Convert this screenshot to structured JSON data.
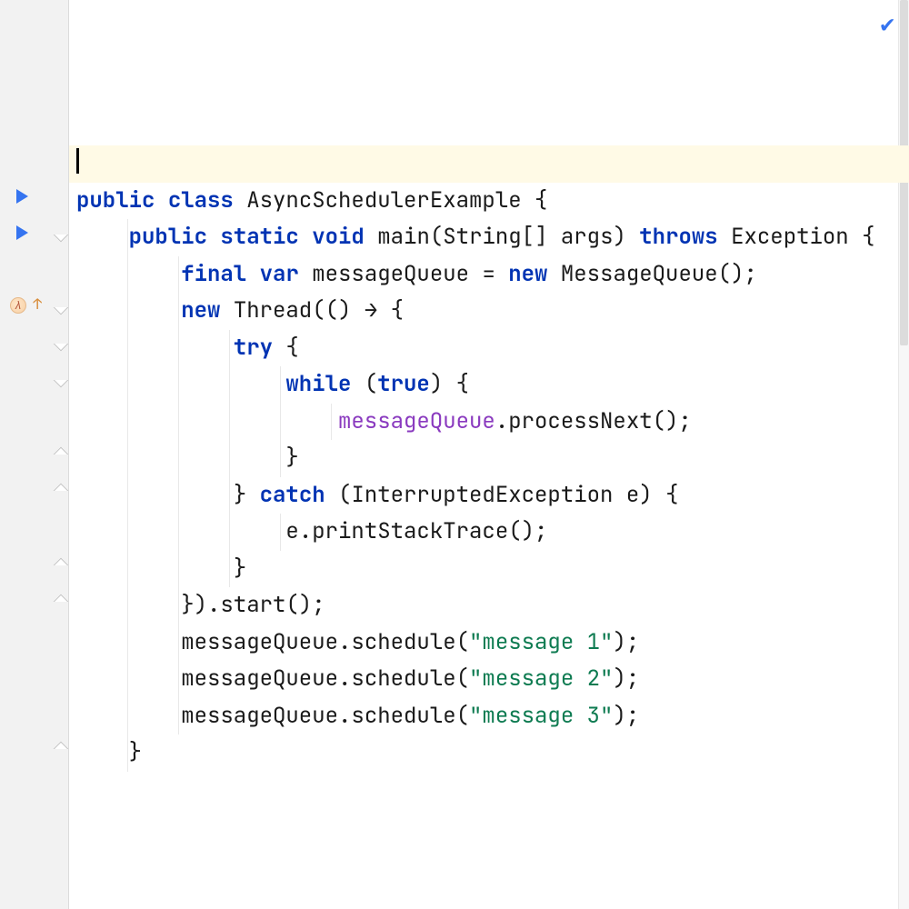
{
  "lines": [
    {
      "indent": 0,
      "type": "cursor"
    },
    {
      "indent": 0,
      "tokens": [
        {
          "t": "kw",
          "v": "public"
        },
        {
          "t": "sp",
          "v": " "
        },
        {
          "t": "kw",
          "v": "class"
        },
        {
          "t": "sp",
          "v": " "
        },
        {
          "t": "id",
          "v": "AsyncSchedulerExample"
        },
        {
          "t": "sp",
          "v": " "
        },
        {
          "t": "punc",
          "v": "{"
        }
      ]
    },
    {
      "indent": 1,
      "tokens": [
        {
          "t": "kw",
          "v": "public"
        },
        {
          "t": "sp",
          "v": " "
        },
        {
          "t": "kw",
          "v": "static"
        },
        {
          "t": "sp",
          "v": " "
        },
        {
          "t": "kw",
          "v": "void"
        },
        {
          "t": "sp",
          "v": " "
        },
        {
          "t": "fn",
          "v": "main"
        },
        {
          "t": "punc",
          "v": "("
        },
        {
          "t": "id",
          "v": "String[] args"
        },
        {
          "t": "punc",
          "v": ")"
        },
        {
          "t": "sp",
          "v": " "
        },
        {
          "t": "kw",
          "v": "throws"
        },
        {
          "t": "sp",
          "v": " "
        },
        {
          "t": "id",
          "v": "Exception"
        },
        {
          "t": "sp",
          "v": " "
        },
        {
          "t": "punc",
          "v": "{"
        }
      ]
    },
    {
      "indent": 2,
      "tokens": [
        {
          "t": "kw",
          "v": "final"
        },
        {
          "t": "sp",
          "v": " "
        },
        {
          "t": "kw",
          "v": "var"
        },
        {
          "t": "sp",
          "v": " "
        },
        {
          "t": "id",
          "v": "messageQueue"
        },
        {
          "t": "sp",
          "v": " "
        },
        {
          "t": "punc",
          "v": "="
        },
        {
          "t": "sp",
          "v": " "
        },
        {
          "t": "kw",
          "v": "new"
        },
        {
          "t": "sp",
          "v": " "
        },
        {
          "t": "id",
          "v": "MessageQueue"
        },
        {
          "t": "punc",
          "v": "();"
        }
      ]
    },
    {
      "indent": 2,
      "tokens": [
        {
          "t": "kw",
          "v": "new"
        },
        {
          "t": "sp",
          "v": " "
        },
        {
          "t": "id",
          "v": "Thread"
        },
        {
          "t": "punc",
          "v": "(() "
        },
        {
          "t": "arrow",
          "v": "→"
        },
        {
          "t": "sp",
          "v": " "
        },
        {
          "t": "punc",
          "v": "{"
        }
      ]
    },
    {
      "indent": 3,
      "tokens": [
        {
          "t": "kw",
          "v": "try"
        },
        {
          "t": "sp",
          "v": " "
        },
        {
          "t": "punc",
          "v": "{"
        }
      ]
    },
    {
      "indent": 4,
      "tokens": [
        {
          "t": "kw",
          "v": "while"
        },
        {
          "t": "sp",
          "v": " "
        },
        {
          "t": "punc",
          "v": "("
        },
        {
          "t": "kw",
          "v": "true"
        },
        {
          "t": "punc",
          "v": ")"
        },
        {
          "t": "sp",
          "v": " "
        },
        {
          "t": "punc",
          "v": "{"
        }
      ]
    },
    {
      "indent": 5,
      "tokens": [
        {
          "t": "fld",
          "v": "messageQueue"
        },
        {
          "t": "punc",
          "v": "."
        },
        {
          "t": "fn",
          "v": "processNext"
        },
        {
          "t": "punc",
          "v": "();"
        }
      ]
    },
    {
      "indent": 4,
      "tokens": [
        {
          "t": "punc",
          "v": "}"
        }
      ]
    },
    {
      "indent": 3,
      "tokens": [
        {
          "t": "punc",
          "v": "}"
        },
        {
          "t": "sp",
          "v": " "
        },
        {
          "t": "kw",
          "v": "catch"
        },
        {
          "t": "sp",
          "v": " "
        },
        {
          "t": "punc",
          "v": "("
        },
        {
          "t": "id",
          "v": "InterruptedException e"
        },
        {
          "t": "punc",
          "v": ")"
        },
        {
          "t": "sp",
          "v": " "
        },
        {
          "t": "punc",
          "v": "{"
        }
      ]
    },
    {
      "indent": 4,
      "tokens": [
        {
          "t": "id",
          "v": "e"
        },
        {
          "t": "punc",
          "v": "."
        },
        {
          "t": "fn",
          "v": "printStackTrace"
        },
        {
          "t": "punc",
          "v": "();"
        }
      ]
    },
    {
      "indent": 3,
      "tokens": [
        {
          "t": "punc",
          "v": "}"
        }
      ]
    },
    {
      "indent": 2,
      "tokens": [
        {
          "t": "punc",
          "v": "})."
        },
        {
          "t": "fn",
          "v": "start"
        },
        {
          "t": "punc",
          "v": "();"
        }
      ]
    },
    {
      "indent": 2,
      "tokens": [
        {
          "t": "id",
          "v": "messageQueue"
        },
        {
          "t": "punc",
          "v": "."
        },
        {
          "t": "fn",
          "v": "schedule"
        },
        {
          "t": "punc",
          "v": "("
        },
        {
          "t": "str",
          "v": "\"message 1\""
        },
        {
          "t": "punc",
          "v": ");"
        }
      ]
    },
    {
      "indent": 2,
      "tokens": [
        {
          "t": "id",
          "v": "messageQueue"
        },
        {
          "t": "punc",
          "v": "."
        },
        {
          "t": "fn",
          "v": "schedule"
        },
        {
          "t": "punc",
          "v": "("
        },
        {
          "t": "str",
          "v": "\"message 2\""
        },
        {
          "t": "punc",
          "v": ");"
        }
      ]
    },
    {
      "indent": 2,
      "tokens": [
        {
          "t": "id",
          "v": "messageQueue"
        },
        {
          "t": "punc",
          "v": "."
        },
        {
          "t": "fn",
          "v": "schedule"
        },
        {
          "t": "punc",
          "v": "("
        },
        {
          "t": "str",
          "v": "\"message 3\""
        },
        {
          "t": "punc",
          "v": ");"
        }
      ]
    },
    {
      "indent": 1,
      "tokens": [
        {
          "t": "punc",
          "v": "}"
        }
      ]
    }
  ],
  "gutter": {
    "runIcons": [
      206,
      246
    ],
    "lambdaIcon": 326,
    "foldOpen": [
      248,
      328,
      370,
      410
    ],
    "foldClose": [
      490,
      530,
      612,
      652,
      816
    ]
  },
  "status": {
    "ok_glyph": "✔"
  },
  "indentUnit": "    "
}
